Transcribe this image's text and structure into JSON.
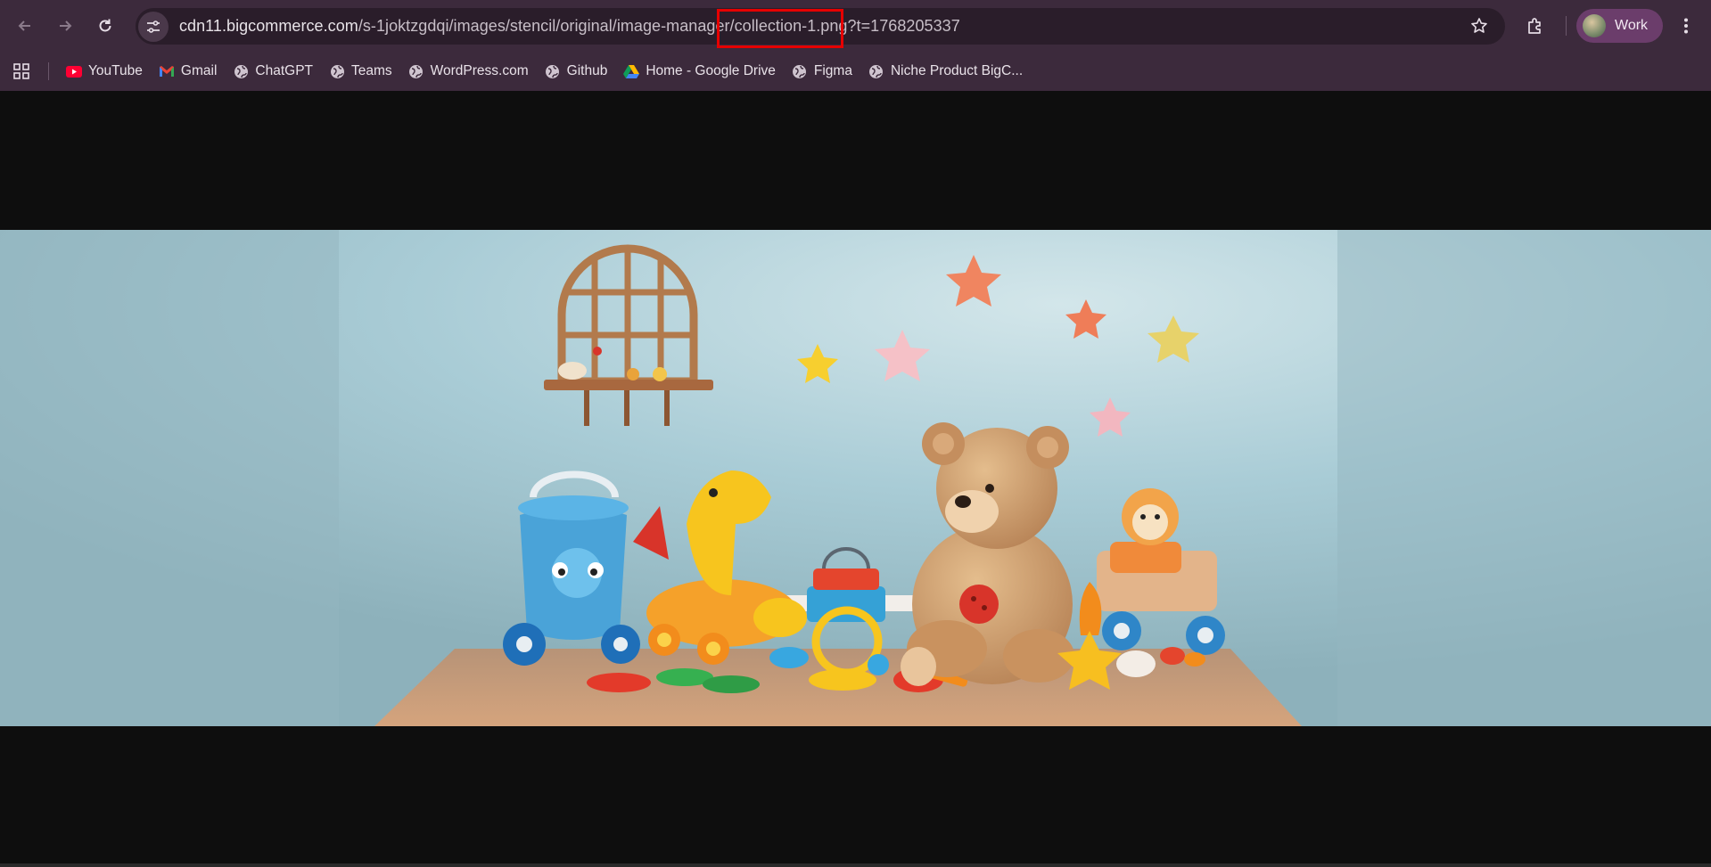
{
  "browser": {
    "url_host": "cdn11.bigcommerce.com",
    "url_path": "/s-1joktzgdqi/images/stencil/original/image-manager/collection-1.png?t=1768205337",
    "profile_label": "Work"
  },
  "bookmarks": [
    {
      "label": "YouTube",
      "icon": "youtube-icon"
    },
    {
      "label": "Gmail",
      "icon": "gmail-icon"
    },
    {
      "label": "ChatGPT",
      "icon": "globe-icon"
    },
    {
      "label": "Teams",
      "icon": "globe-icon"
    },
    {
      "label": "WordPress.com",
      "icon": "globe-icon"
    },
    {
      "label": "Github",
      "icon": "globe-icon"
    },
    {
      "label": "Home - Google Drive",
      "icon": "google-drive-icon"
    },
    {
      "label": "Figma",
      "icon": "globe-icon"
    },
    {
      "label": "Niche Product BigC...",
      "icon": "globe-icon"
    }
  ],
  "colors": {
    "toolbar": "#3c2a3c",
    "omnibox": "#2a1d2a",
    "highlight": "#e60000",
    "page_background": "#0e0e0e"
  }
}
